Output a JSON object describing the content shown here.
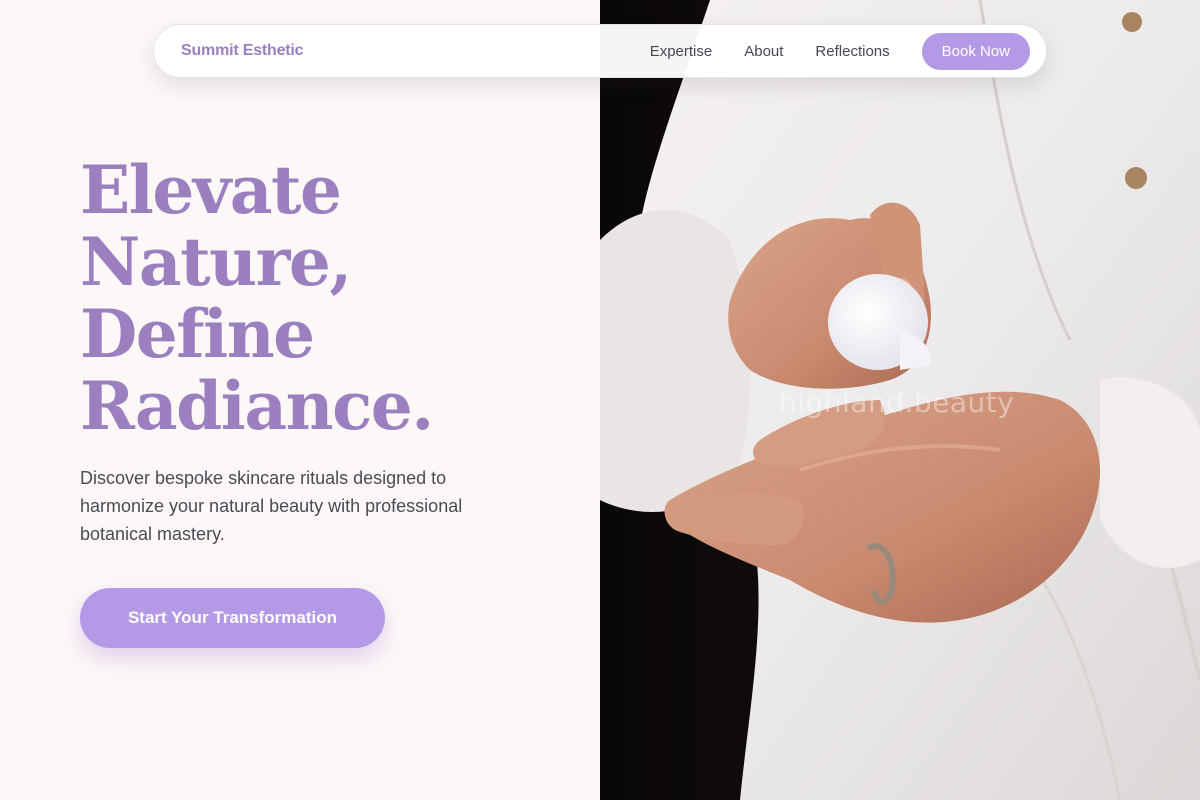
{
  "nav": {
    "brand": "Summit Esthetic",
    "links": [
      "Expertise",
      "About",
      "Reflections"
    ],
    "cta_label": "Book Now"
  },
  "hero": {
    "headline": [
      "Elevate",
      "Nature,",
      "Define",
      "Radiance."
    ],
    "subtitle": "Discover bespoke skincare rituals designed to harmonize your natural beauty with professional botanical mastery.",
    "cta_label": "Start Your Transformation",
    "watermark": "highland.beauty"
  },
  "colors": {
    "accent": "#b49ae6",
    "brand_text": "#9b7fbf",
    "background": "#fcf8f7",
    "body_text": "#4b4b55"
  }
}
